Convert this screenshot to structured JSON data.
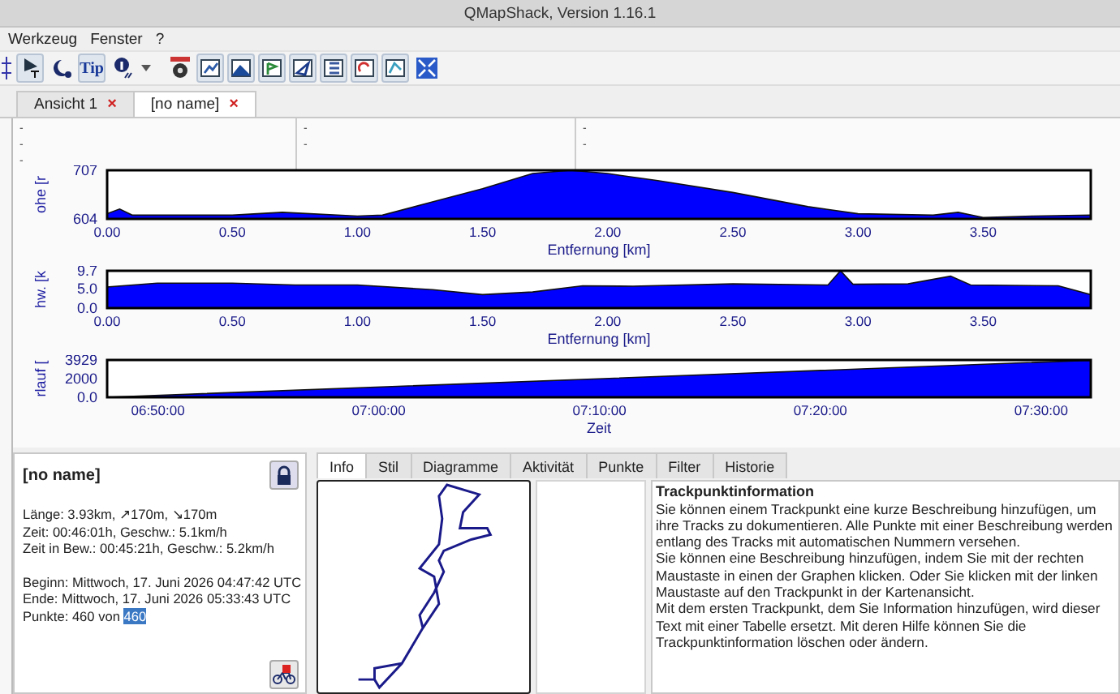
{
  "window": {
    "title": "QMapShack, Version 1.16.1"
  },
  "menu": [
    "Werkzeug",
    "Fenster",
    "?"
  ],
  "toolbar": {
    "tip_label": "Tip"
  },
  "view_tabs": [
    {
      "label": "Ansicht 1",
      "close": "×",
      "selected": false
    },
    {
      "label": "[no name]",
      "close": "×",
      "selected": true
    }
  ],
  "info_columns": [
    [
      "-",
      "-",
      "-"
    ],
    [
      "-",
      "-"
    ],
    [
      "-",
      "-"
    ]
  ],
  "charts": [
    {
      "chart_data": {
        "type": "area",
        "ylabel": "ohe [r",
        "xlabel": "Entfernung [km]",
        "x": [
          0,
          0.05,
          0.1,
          0.5,
          0.7,
          1.0,
          1.1,
          1.3,
          1.5,
          1.7,
          1.85,
          2.0,
          2.2,
          2.5,
          2.8,
          3.0,
          3.3,
          3.4,
          3.5,
          3.7,
          3.93
        ],
        "series": [
          {
            "color": "#0000ff",
            "values": [
              615,
              625,
              612,
              612,
              618,
              610,
              612,
              640,
              668,
              700,
              707,
              700,
              685,
              660,
              630,
              615,
              612,
              618,
              607,
              610,
              612
            ]
          }
        ],
        "xlim": [
          0,
          3.93
        ],
        "ylim": [
          604,
          707
        ],
        "yticks": [
          604,
          707
        ],
        "xticks": [
          {
            "value": 0,
            "label": "0.00"
          },
          {
            "value": 0.5,
            "label": "0.50"
          },
          {
            "value": 1,
            "label": "1.00"
          },
          {
            "value": 1.5,
            "label": "1.50"
          },
          {
            "value": 2,
            "label": "2.00"
          },
          {
            "value": 2.5,
            "label": "2.50"
          },
          {
            "value": 3,
            "label": "3.00"
          },
          {
            "value": 3.5,
            "label": "3.50"
          }
        ]
      }
    },
    {
      "chart_data": {
        "type": "area",
        "ylabel": "hw. [k",
        "xlabel": "Entfernung [km]",
        "x": [
          0,
          0.2,
          0.5,
          0.75,
          1.0,
          1.3,
          1.5,
          1.7,
          1.9,
          2.1,
          2.5,
          2.88,
          2.93,
          2.98,
          3.2,
          3.37,
          3.45,
          3.8,
          3.93
        ],
        "series": [
          {
            "color": "#0000ff",
            "values": [
              5.5,
              6.5,
              6.5,
              6,
              6,
              4.8,
              3.5,
              4.2,
              5.8,
              5.7,
              6.3,
              6,
              9.7,
              6.2,
              6.3,
              8.3,
              6,
              5.8,
              3.5
            ]
          }
        ],
        "xlim": [
          0,
          3.93
        ],
        "ylim": [
          0,
          9.7
        ],
        "yticks": [
          {
            "value": 0,
            "label": "0.0"
          },
          {
            "value": 5,
            "label": "5.0"
          },
          {
            "value": 9.7,
            "label": "9.7"
          }
        ],
        "xticks": [
          {
            "value": 0,
            "label": "0.00"
          },
          {
            "value": 0.5,
            "label": "0.50"
          },
          {
            "value": 1,
            "label": "1.00"
          },
          {
            "value": 1.5,
            "label": "1.50"
          },
          {
            "value": 2,
            "label": "2.00"
          },
          {
            "value": 2.5,
            "label": "2.50"
          },
          {
            "value": 3,
            "label": "3.00"
          },
          {
            "value": 3.5,
            "label": "3.50"
          }
        ]
      }
    },
    {
      "chart_data": {
        "type": "area",
        "ylabel": "rlauf [",
        "xlabel": "Zeit",
        "x": [
          24462,
          27135
        ],
        "series": [
          {
            "color": "#0000ff",
            "values": [
              0,
              3900
            ]
          }
        ],
        "xlim": [
          24462,
          27135
        ],
        "ylim": [
          0,
          3929
        ],
        "yticks": [
          {
            "value": 0,
            "label": "0.0"
          },
          2000,
          3929
        ],
        "xticks": [
          {
            "value": 24600,
            "label": "06:50:00"
          },
          {
            "value": 25200,
            "label": "07:00:00"
          },
          {
            "value": 25800,
            "label": "07:10:00"
          },
          {
            "value": 26400,
            "label": "07:20:00"
          },
          {
            "value": 27000,
            "label": "07:30:00"
          }
        ]
      }
    }
  ],
  "track": {
    "name": "[no name]",
    "stats": [
      "Länge: 3.93km, ↗170m, ↘170m",
      "Zeit: 00:46:01h, Geschw.: 5.1km/h",
      "Zeit in Bew.: 00:45:21h, Geschw.: 5.2km/h"
    ],
    "times": [
      "Beginn: Mittwoch, 17. Juni 2026 04:47:42 UTC",
      "Ende: Mittwoch, 17. Juni 2026 05:33:43 UTC"
    ],
    "points": {
      "text": "Punkte: 460 von ",
      "highlight": "460",
      "selected": true
    },
    "locked": true
  },
  "detail_tabs": [
    {
      "label": "Info",
      "selected": true
    },
    {
      "label": "Stil",
      "selected": false
    },
    {
      "label": "Diagramme",
      "selected": false
    },
    {
      "label": "Aktivität",
      "selected": false
    },
    {
      "label": "Punkte",
      "selected": false
    },
    {
      "label": "Filter",
      "selected": false
    },
    {
      "label": "Historie",
      "selected": false
    }
  ],
  "trackpoint_info": {
    "title": "Trackpunktinformation",
    "paragraphs": [
      "Sie können einem Trackpunkt eine kurze Beschreibung hinzufügen, um ihre Tracks zu dokumentieren. Alle Punkte mit einer Beschreibung werden entlang des Tracks mit automatischen Nummern versehen.",
      "Sie können eine Beschreibung hinzufügen, indem Sie mit der rechten Maustaste in einen der Graphen klicken. Oder Sie klicken mit der linken Maustaste auf den Trackpunkt in der Kartenansicht.",
      "Mit dem ersten Trackpunkt, dem Sie Information hinzufügen, wird dieser Text mit einer Tabelle ersetzt. Mit deren Hilfe können Sie die Trackpunktinformation löschen oder ändern."
    ]
  }
}
